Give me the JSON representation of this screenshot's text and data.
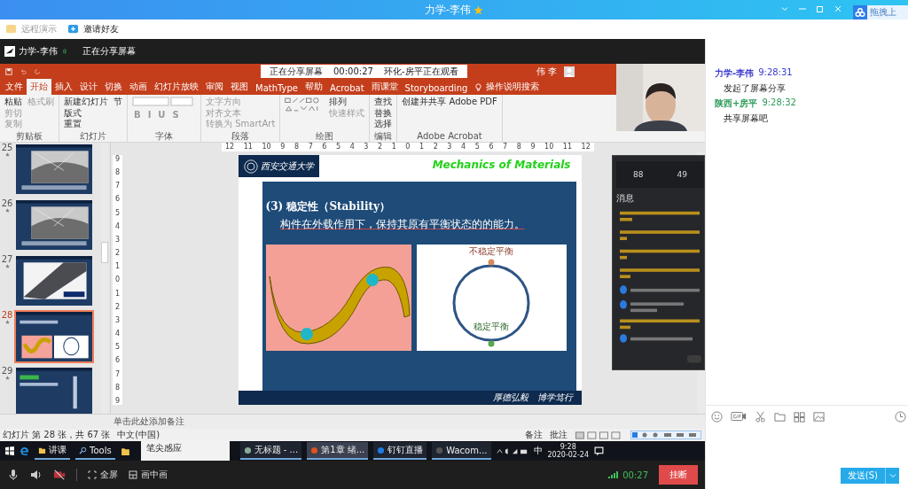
{
  "window": {
    "title": "力学-李伟",
    "starred": true,
    "side_widget": "拖拽上"
  },
  "toolbar": [
    {
      "label": "远程演示",
      "disabled": true
    },
    {
      "label": "邀请好友",
      "disabled": false
    }
  ],
  "share_header": {
    "name": "力学-李伟",
    "status": "正在分享屏幕"
  },
  "share_notice": [
    "正在分享屏幕",
    "00:00:27",
    "环化-房平正在观看"
  ],
  "ppt": {
    "user": "伟 李",
    "tabs": [
      {
        "label": "文件",
        "selected": false
      },
      {
        "label": "开始",
        "selected": true
      },
      {
        "label": "插入",
        "selected": false
      },
      {
        "label": "设计",
        "selected": false
      },
      {
        "label": "切换",
        "selected": false
      },
      {
        "label": "动画",
        "selected": false
      },
      {
        "label": "幻灯片放映",
        "selected": false
      },
      {
        "label": "审阅",
        "selected": false
      },
      {
        "label": "视图",
        "selected": false
      },
      {
        "label": "MathType",
        "selected": false
      },
      {
        "label": "帮助",
        "selected": false
      },
      {
        "label": "Acrobat",
        "selected": false
      },
      {
        "label": "雨课堂",
        "selected": false
      },
      {
        "label": "Storyboarding",
        "selected": false
      }
    ],
    "tell_me": "操作说明搜索",
    "groups": [
      {
        "name": "剪贴板",
        "items": [
          {
            "label": "粘贴",
            "disabled": false
          },
          {
            "label": "剪切",
            "disabled": true
          },
          {
            "label": "复制",
            "disabled": true
          },
          {
            "label": "格式刷",
            "disabled": true
          }
        ]
      },
      {
        "name": "幻灯片",
        "items": [
          {
            "label": "新建幻灯片",
            "disabled": false
          },
          {
            "label": "版式",
            "disabled": false
          },
          {
            "label": "重置",
            "disabled": false
          },
          {
            "label": "节",
            "disabled": false
          }
        ]
      },
      {
        "name": "字体",
        "items": [
          {
            "label": "B",
            "disabled": true
          },
          {
            "label": "I",
            "disabled": true
          },
          {
            "label": "U",
            "disabled": true
          },
          {
            "label": "S",
            "disabled": true
          }
        ]
      },
      {
        "name": "段落",
        "items": [
          {
            "label": "文字方向",
            "disabled": true
          },
          {
            "label": "对齐文本",
            "disabled": true
          },
          {
            "label": "转换为 SmartArt",
            "disabled": true
          }
        ]
      },
      {
        "name": "绘图",
        "items": [
          {
            "label": "排列",
            "disabled": false
          },
          {
            "label": "快速样式",
            "disabled": true
          }
        ]
      },
      {
        "name": "编辑",
        "items": [
          {
            "label": "查找",
            "disabled": false
          },
          {
            "label": "替换",
            "disabled": false
          },
          {
            "label": "选择",
            "disabled": false
          }
        ]
      },
      {
        "name": "Adobe Acrobat",
        "items": [
          {
            "label": "创建并共享 Adobe PDF",
            "disabled": false
          }
        ]
      }
    ],
    "ruler": [
      "12",
      "11",
      "10",
      "9",
      "8",
      "7",
      "6",
      "5",
      "4",
      "3",
      "2",
      "1",
      "0",
      "1",
      "2",
      "3",
      "4",
      "5",
      "6",
      "7",
      "8",
      "9",
      "10",
      "11",
      "12"
    ],
    "vruler": [
      "9",
      "8",
      "7",
      "6",
      "5",
      "4",
      "3",
      "2",
      "1",
      "0",
      "1",
      "2",
      "3",
      "4",
      "5",
      "6",
      "7",
      "8",
      "9"
    ],
    "thumbnails": [
      {
        "number": "25",
        "kind": "bridge",
        "selected": false
      },
      {
        "number": "26",
        "kind": "bridge",
        "selected": false
      },
      {
        "number": "27",
        "kind": "cable",
        "selected": false
      },
      {
        "number": "28",
        "kind": "current",
        "selected": true
      },
      {
        "number": "29",
        "kind": "figure",
        "selected": false
      }
    ],
    "slide": {
      "logo": "西安交通大学",
      "banner": "Mechanics of Materials",
      "heading": "(3) 稳定性（Stability）",
      "body": "构件在外载作用下，保持其原有平衡状态的的能力。",
      "unstable": "不稳定平衡",
      "stable": "稳定平衡",
      "motto": "厚德弘毅　博学笃行"
    },
    "notes": "单击此处添加备注",
    "status": {
      "slide_count": "幻灯片 第 28 张，共 67 张",
      "language": "中文(中国)",
      "notes": "备注",
      "comments": "批注"
    }
  },
  "overlay": {
    "stats": [
      "88",
      "49"
    ],
    "heading": "消息"
  },
  "taskbar": {
    "pinned": [
      "讲课",
      "Tools"
    ],
    "panel": "笔尖感应",
    "tasks": [
      {
        "label": "无标题 - ...",
        "selected": false
      },
      {
        "label": "第1章 绪...",
        "selected": true
      },
      {
        "label": "钉钉直播",
        "selected": false
      },
      {
        "label": "Wacom...",
        "selected": false
      }
    ],
    "ime": "中",
    "time": "9:28",
    "date": "2020-02-24"
  },
  "chat": {
    "messages": [
      {
        "sender": "力学-李伟",
        "time": "9:28:31",
        "text": "发起了屏幕分享",
        "color": "#3a3ad0"
      },
      {
        "sender": "陕西+房平",
        "time": "9:28:32",
        "text": "共享屏幕吧",
        "color": "#2e9a5a"
      }
    ],
    "send": "发送(S)"
  },
  "controls": {
    "camera_on": false,
    "fullscreen": "全屏",
    "pip": "画中画",
    "duration": "00:27",
    "hangup": "挂断"
  }
}
